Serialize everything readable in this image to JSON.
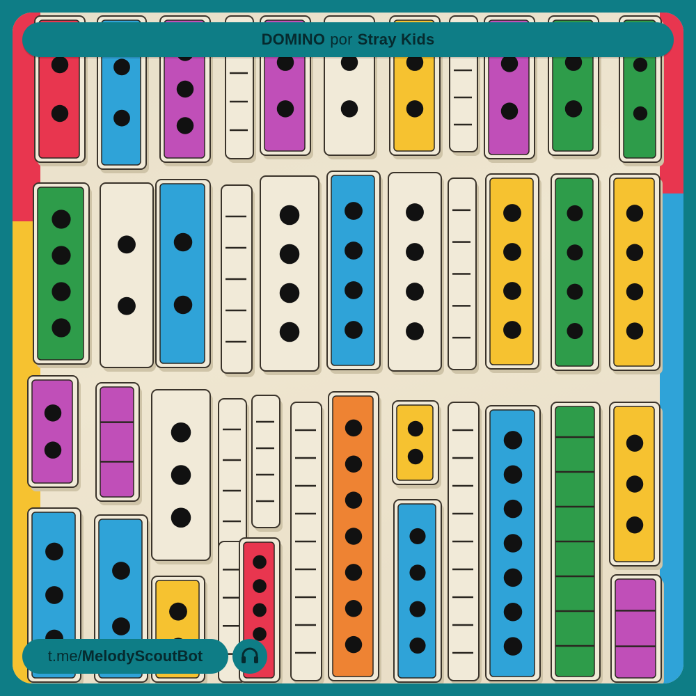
{
  "header": {
    "song_title": "DOMINO",
    "connector": "por",
    "artist": "Stray Kids"
  },
  "footer": {
    "handle_prefix": "t.me/",
    "handle_name": "MelodyScoutBot",
    "headphones_icon": "headphones-icon"
  },
  "colors": {
    "frame": "#0e7d86",
    "pill_text": "#062a2e",
    "red": "#e8364f",
    "blue": "#2fa3d8",
    "magenta": "#c04fb8",
    "cream": "#f1ead8",
    "yellow": "#f6c230",
    "green": "#2e9c4a",
    "orange": "#ee8333"
  }
}
